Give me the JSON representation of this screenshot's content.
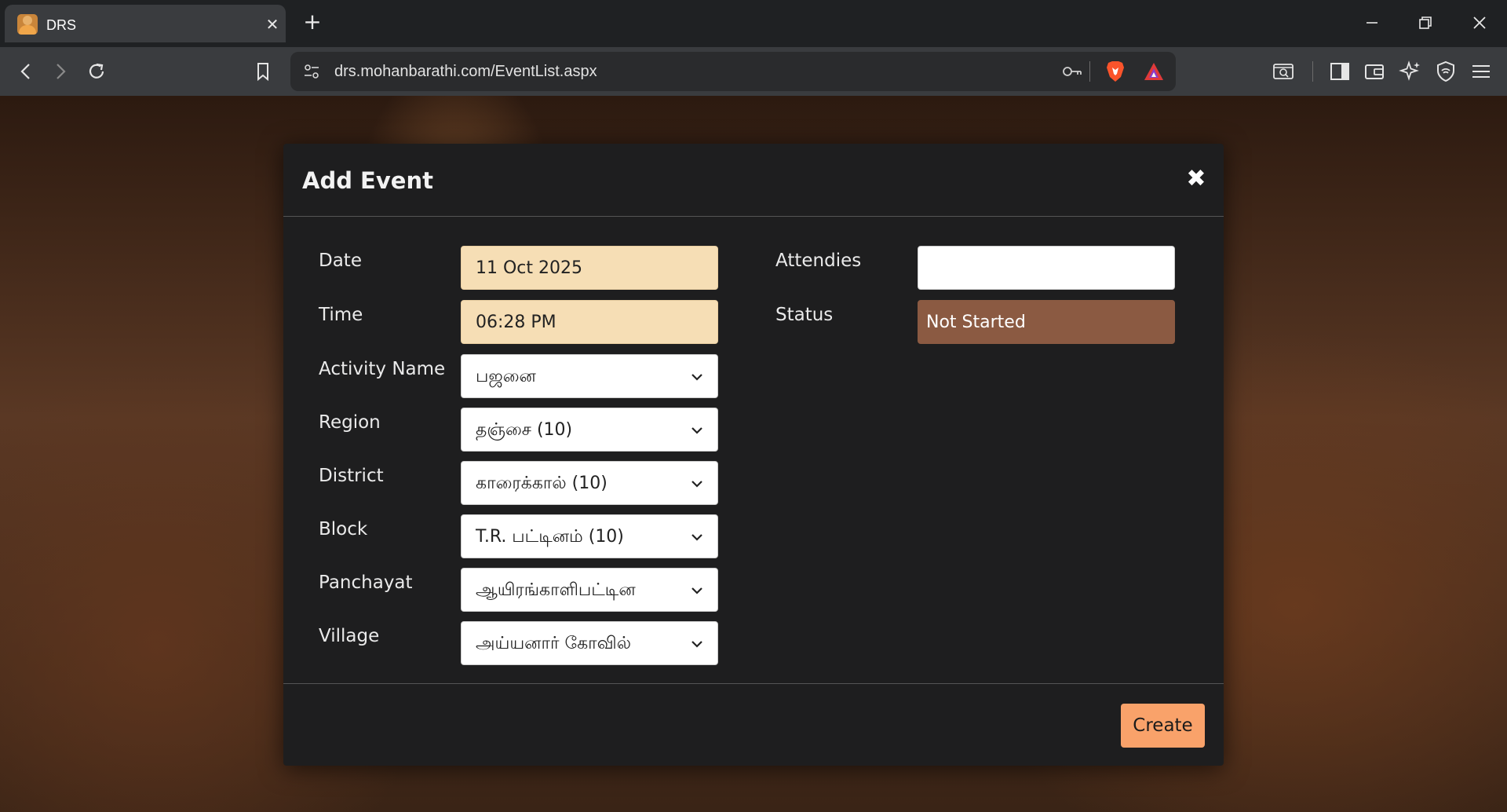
{
  "browser": {
    "tab_title": "DRS",
    "url": "drs.mohanbarathi.com/EventList.aspx"
  },
  "modal": {
    "title": "Add Event",
    "fields": {
      "date": {
        "label": "Date",
        "value": "11 Oct 2025"
      },
      "time": {
        "label": "Time",
        "value": "06:28 PM"
      },
      "activity": {
        "label": "Activity Name",
        "value": "பஜனை"
      },
      "region": {
        "label": "Region",
        "value": "தஞ்சை (10)"
      },
      "district": {
        "label": "District",
        "value": "காரைக்கால் (10)"
      },
      "block": {
        "label": "Block",
        "value": "T.R. பட்டினம் (10)"
      },
      "panchayat": {
        "label": "Panchayat",
        "value": "ஆயிரங்காளிபட்டின"
      },
      "village": {
        "label": "Village",
        "value": "அய்யனார் கோவில்"
      },
      "attendies": {
        "label": "Attendies",
        "value": ""
      },
      "status": {
        "label": "Status",
        "value": "Not Started"
      }
    },
    "create_label": "Create"
  },
  "colors": {
    "readonly_bg": "#f6deb5",
    "status_bg": "#8b5a42",
    "create_bg": "#f9a26a",
    "modal_bg": "#1e1e1f"
  }
}
